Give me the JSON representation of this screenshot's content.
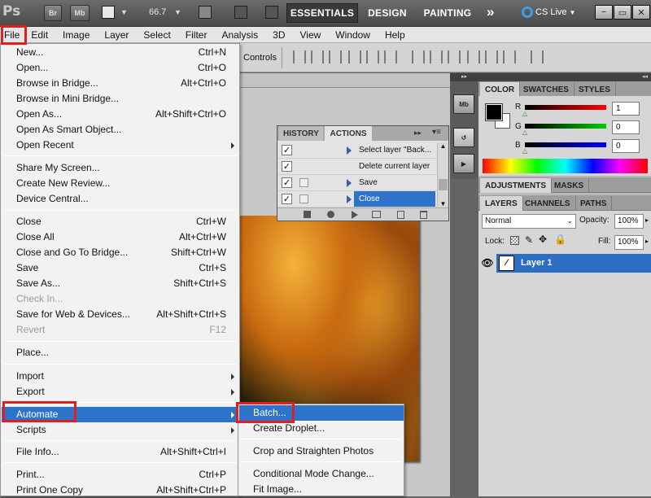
{
  "appbar": {
    "logo": "Ps",
    "br": "Br",
    "mb": "Mb",
    "zoom": "66.7",
    "workspaces": [
      "ESSENTIALS",
      "DESIGN",
      "PAINTING"
    ],
    "more": "»",
    "cslive": "CS Live",
    "window_buttons": [
      "−",
      "▭",
      "✕"
    ]
  },
  "menubar": [
    "File",
    "Edit",
    "Image",
    "Layer",
    "Select",
    "Filter",
    "Analysis",
    "3D",
    "View",
    "Window",
    "Help"
  ],
  "options": {
    "controls_label": "Controls"
  },
  "file_menu": [
    {
      "label": "New...",
      "shortcut": "Ctrl+N"
    },
    {
      "label": "Open...",
      "shortcut": "Ctrl+O"
    },
    {
      "label": "Browse in Bridge...",
      "shortcut": "Alt+Ctrl+O"
    },
    {
      "label": "Browse in Mini Bridge...",
      "shortcut": ""
    },
    {
      "label": "Open As...",
      "shortcut": "Alt+Shift+Ctrl+O"
    },
    {
      "label": "Open As Smart Object...",
      "shortcut": ""
    },
    {
      "label": "Open Recent",
      "shortcut": ""
    },
    {
      "label": "Share My Screen...",
      "shortcut": ""
    },
    {
      "label": "Create New Review...",
      "shortcut": ""
    },
    {
      "label": "Device Central...",
      "shortcut": ""
    },
    {
      "label": "Close",
      "shortcut": "Ctrl+W"
    },
    {
      "label": "Close All",
      "shortcut": "Alt+Ctrl+W"
    },
    {
      "label": "Close and Go To Bridge...",
      "shortcut": "Shift+Ctrl+W"
    },
    {
      "label": "Save",
      "shortcut": "Ctrl+S"
    },
    {
      "label": "Save As...",
      "shortcut": "Shift+Ctrl+S"
    },
    {
      "label": "Check In...",
      "shortcut": ""
    },
    {
      "label": "Save for Web & Devices...",
      "shortcut": "Alt+Shift+Ctrl+S"
    },
    {
      "label": "Revert",
      "shortcut": "F12"
    },
    {
      "label": "Place...",
      "shortcut": ""
    },
    {
      "label": "Import",
      "shortcut": ""
    },
    {
      "label": "Export",
      "shortcut": ""
    },
    {
      "label": "Automate",
      "shortcut": ""
    },
    {
      "label": "Scripts",
      "shortcut": ""
    },
    {
      "label": "File Info...",
      "shortcut": "Alt+Shift+Ctrl+I"
    },
    {
      "label": "Print...",
      "shortcut": "Ctrl+P"
    },
    {
      "label": "Print One Copy",
      "shortcut": "Alt+Shift+Ctrl+P"
    }
  ],
  "automate_submenu": [
    "Batch...",
    "Create Droplet...",
    "Crop and Straighten Photos",
    "Conditional Mode Change...",
    "Fit Image..."
  ],
  "history_panel": {
    "tabs": [
      "HISTORY",
      "ACTIONS"
    ],
    "rows": [
      "Select layer \"Back...",
      "Delete current layer",
      "Save",
      "Close"
    ]
  },
  "dock_icons": [
    "Mb"
  ],
  "color_panel": {
    "tabs": [
      "COLOR",
      "SWATCHES",
      "STYLES"
    ],
    "channels": [
      {
        "label": "R",
        "value": "1"
      },
      {
        "label": "G",
        "value": "0"
      },
      {
        "label": "B",
        "value": "0"
      }
    ],
    "colors": {
      "red": "#d11e1e",
      "green": "#1fb82a",
      "blue": "#1f2fd6"
    }
  },
  "adjust_panel": {
    "tabs": [
      "ADJUSTMENTS",
      "MASKS"
    ]
  },
  "layers_panel": {
    "tabs": [
      "LAYERS",
      "CHANNELS",
      "PATHS"
    ],
    "blend_mode": "Normal",
    "opacity_label": "Opacity:",
    "opacity": "100%",
    "lock_label": "Lock:",
    "fill_label": "Fill:",
    "fill": "100%",
    "layer_name": "Layer 1"
  },
  "accent": "#2d73c9",
  "highlight_color": "#e02020"
}
